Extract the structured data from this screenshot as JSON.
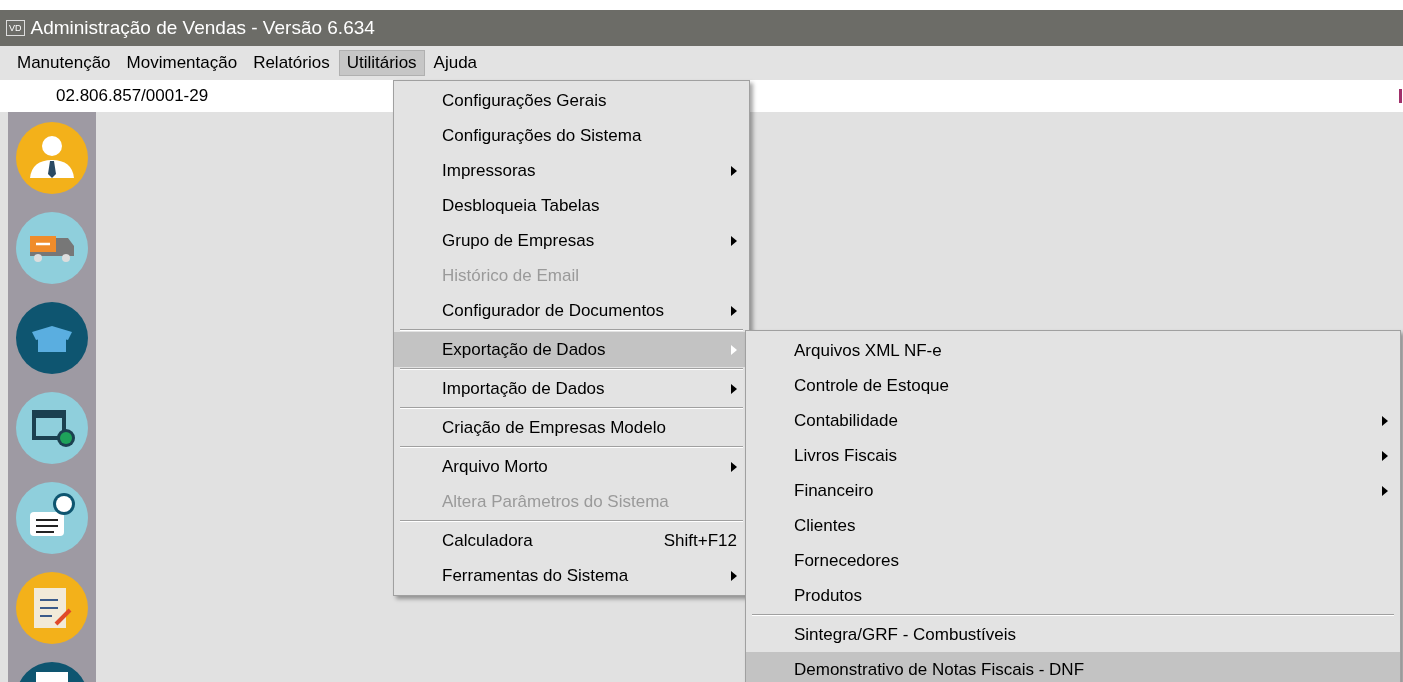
{
  "window": {
    "logo": "VD",
    "title": "Administração de Vendas - Versão 6.634"
  },
  "menubar": [
    {
      "label": "Manutenção",
      "selected": false
    },
    {
      "label": "Movimentação",
      "selected": false
    },
    {
      "label": "Relatórios",
      "selected": false
    },
    {
      "label": "Utilitários",
      "selected": true
    },
    {
      "label": "Ajuda",
      "selected": false
    }
  ],
  "company_id": "02.806.857/0001-29",
  "menu": [
    {
      "kind": "item",
      "label": "Configurações Gerais",
      "disabled": false,
      "selected": false,
      "submenu": false
    },
    {
      "kind": "item",
      "label": "Configurações do Sistema",
      "disabled": false,
      "selected": false,
      "submenu": false
    },
    {
      "kind": "item",
      "label": "Impressoras",
      "disabled": false,
      "selected": false,
      "submenu": true
    },
    {
      "kind": "item",
      "label": "Desbloqueia Tabelas",
      "disabled": false,
      "selected": false,
      "submenu": false
    },
    {
      "kind": "item",
      "label": "Grupo de Empresas",
      "disabled": false,
      "selected": false,
      "submenu": true
    },
    {
      "kind": "item",
      "label": "Histórico de Email",
      "disabled": true,
      "selected": false,
      "submenu": false
    },
    {
      "kind": "item",
      "label": "Configurador de Documentos",
      "disabled": false,
      "selected": false,
      "submenu": true
    },
    {
      "kind": "separator"
    },
    {
      "kind": "item",
      "label": "Exportação de Dados",
      "disabled": false,
      "selected": true,
      "submenu": true
    },
    {
      "kind": "separator"
    },
    {
      "kind": "item",
      "label": "Importação de Dados",
      "disabled": false,
      "selected": false,
      "submenu": true
    },
    {
      "kind": "separator"
    },
    {
      "kind": "item",
      "label": "Criação de Empresas Modelo",
      "disabled": false,
      "selected": false,
      "submenu": false
    },
    {
      "kind": "separator"
    },
    {
      "kind": "item",
      "label": "Arquivo Morto",
      "disabled": false,
      "selected": false,
      "submenu": true
    },
    {
      "kind": "item",
      "label": "Altera Parâmetros do Sistema",
      "disabled": true,
      "selected": false,
      "submenu": false
    },
    {
      "kind": "separator"
    },
    {
      "kind": "item",
      "label": "Calculadora",
      "shortcut": "Shift+F12",
      "disabled": false,
      "selected": false,
      "submenu": false
    },
    {
      "kind": "item",
      "label": "Ferramentas do Sistema",
      "disabled": false,
      "selected": false,
      "submenu": true
    }
  ],
  "submenu": [
    {
      "kind": "item",
      "label": "Arquivos XML NF-e",
      "disabled": false,
      "selected": false,
      "submenu": false
    },
    {
      "kind": "item",
      "label": "Controle de Estoque",
      "disabled": false,
      "selected": false,
      "submenu": false
    },
    {
      "kind": "item",
      "label": "Contabilidade",
      "disabled": false,
      "selected": false,
      "submenu": true
    },
    {
      "kind": "item",
      "label": "Livros Fiscais",
      "disabled": false,
      "selected": false,
      "submenu": true
    },
    {
      "kind": "item",
      "label": "Financeiro",
      "disabled": false,
      "selected": false,
      "submenu": true
    },
    {
      "kind": "item",
      "label": "Clientes",
      "disabled": false,
      "selected": false,
      "submenu": false
    },
    {
      "kind": "item",
      "label": "Fornecedores",
      "disabled": false,
      "selected": false,
      "submenu": false
    },
    {
      "kind": "item",
      "label": "Produtos",
      "disabled": false,
      "selected": false,
      "submenu": false
    },
    {
      "kind": "separator"
    },
    {
      "kind": "item",
      "label": "Sintegra/GRF - Combustíveis",
      "disabled": false,
      "selected": false,
      "submenu": false
    },
    {
      "kind": "item",
      "label": "Demonstrativo de Notas Fiscais - DNF",
      "disabled": false,
      "selected": true,
      "submenu": false
    }
  ]
}
